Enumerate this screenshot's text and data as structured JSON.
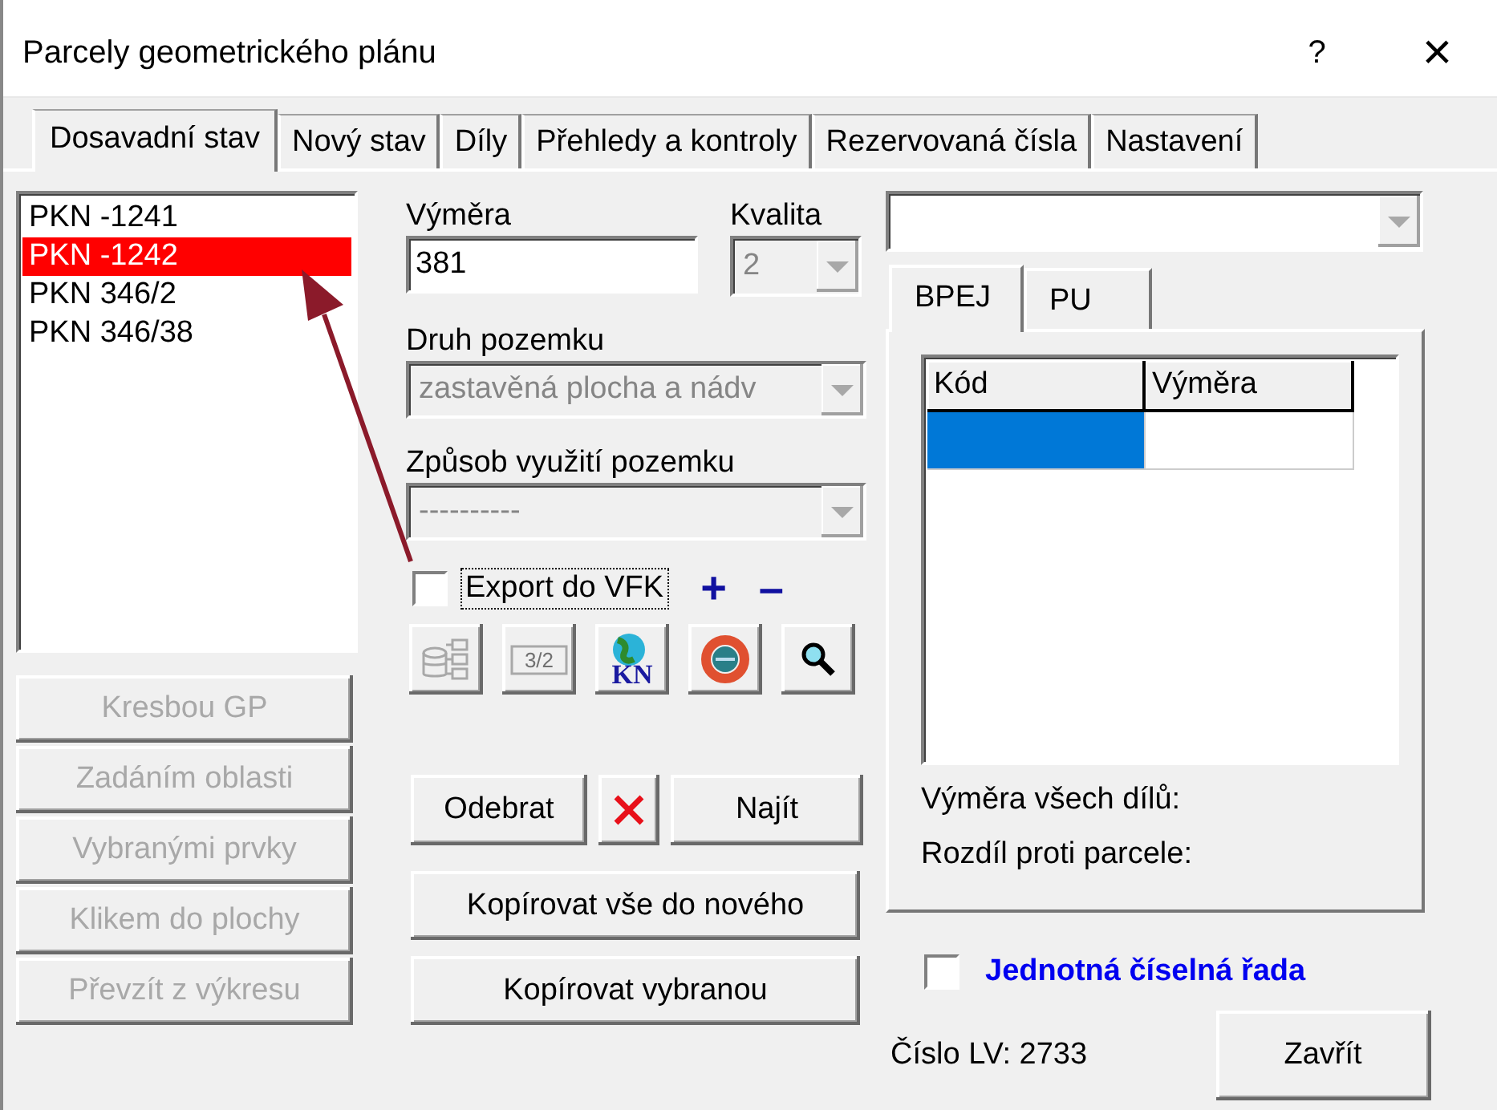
{
  "window": {
    "title": "Parcely geometrického plánu",
    "help": "?",
    "close": "×"
  },
  "tabs": [
    {
      "label": "Dosavadní stav",
      "selected": true
    },
    {
      "label": "Nový stav",
      "selected": false
    },
    {
      "label": "Díly",
      "selected": false
    },
    {
      "label": "Přehledy a kontroly",
      "selected": false
    },
    {
      "label": "Rezervovaná čísla",
      "selected": false
    },
    {
      "label": "Nastavení",
      "selected": false
    }
  ],
  "parcels": [
    {
      "label": "PKN -1241",
      "selected": false
    },
    {
      "label": "PKN -1242",
      "selected": true
    },
    {
      "label": "PKN 346/2",
      "selected": false
    },
    {
      "label": "PKN 346/38",
      "selected": false
    }
  ],
  "method_buttons": [
    {
      "label": "Kresbou GP",
      "disabled": true
    },
    {
      "label": "Zadáním oblasti",
      "disabled": true
    },
    {
      "label": "Vybranými prvky",
      "disabled": true
    },
    {
      "label": "Klikem do plochy",
      "disabled": true
    },
    {
      "label": "Převzít z výkresu",
      "disabled": true
    }
  ],
  "area": {
    "label": "Výměra",
    "value": "381"
  },
  "quality": {
    "label": "Kvalita",
    "value": "2",
    "disabled": true
  },
  "land_type": {
    "label": "Druh pozemku",
    "value": "zastavěná plocha a nádv",
    "disabled": true
  },
  "land_use": {
    "label": "Způsob využití pozemku",
    "value": "----------",
    "disabled": true
  },
  "export": {
    "label": "Export do VFK",
    "checked": false,
    "plus": "+",
    "minus": "–"
  },
  "icon_buttons": [
    {
      "kind": "tree",
      "disabled": true
    },
    {
      "kind": "fraction",
      "label": "3/2",
      "disabled": true
    },
    {
      "kind": "globe",
      "label": "KN",
      "disabled": false
    },
    {
      "kind": "lifebuoy",
      "disabled": false
    },
    {
      "kind": "search",
      "disabled": false
    }
  ],
  "actions": {
    "remove": "Odebrat",
    "find": "Najít",
    "copy_all": "Kopírovat vše do nového",
    "copy_selected": "Kopírovat vybranou"
  },
  "subtabs": [
    {
      "label": "BPEJ",
      "selected": true
    },
    {
      "label": "PU",
      "selected": false
    }
  ],
  "table": {
    "columns": [
      "Kód",
      "Výměra"
    ],
    "rows": [
      {
        "selected": true
      }
    ]
  },
  "totals": [
    "Výměra všech dílů:",
    "Rozdíl proti parcele:"
  ],
  "uniform_series": {
    "label": "Jednotná číselná řada",
    "checked": false
  },
  "lv": "Číslo LV: 2733",
  "close_button": "Zavřít"
}
